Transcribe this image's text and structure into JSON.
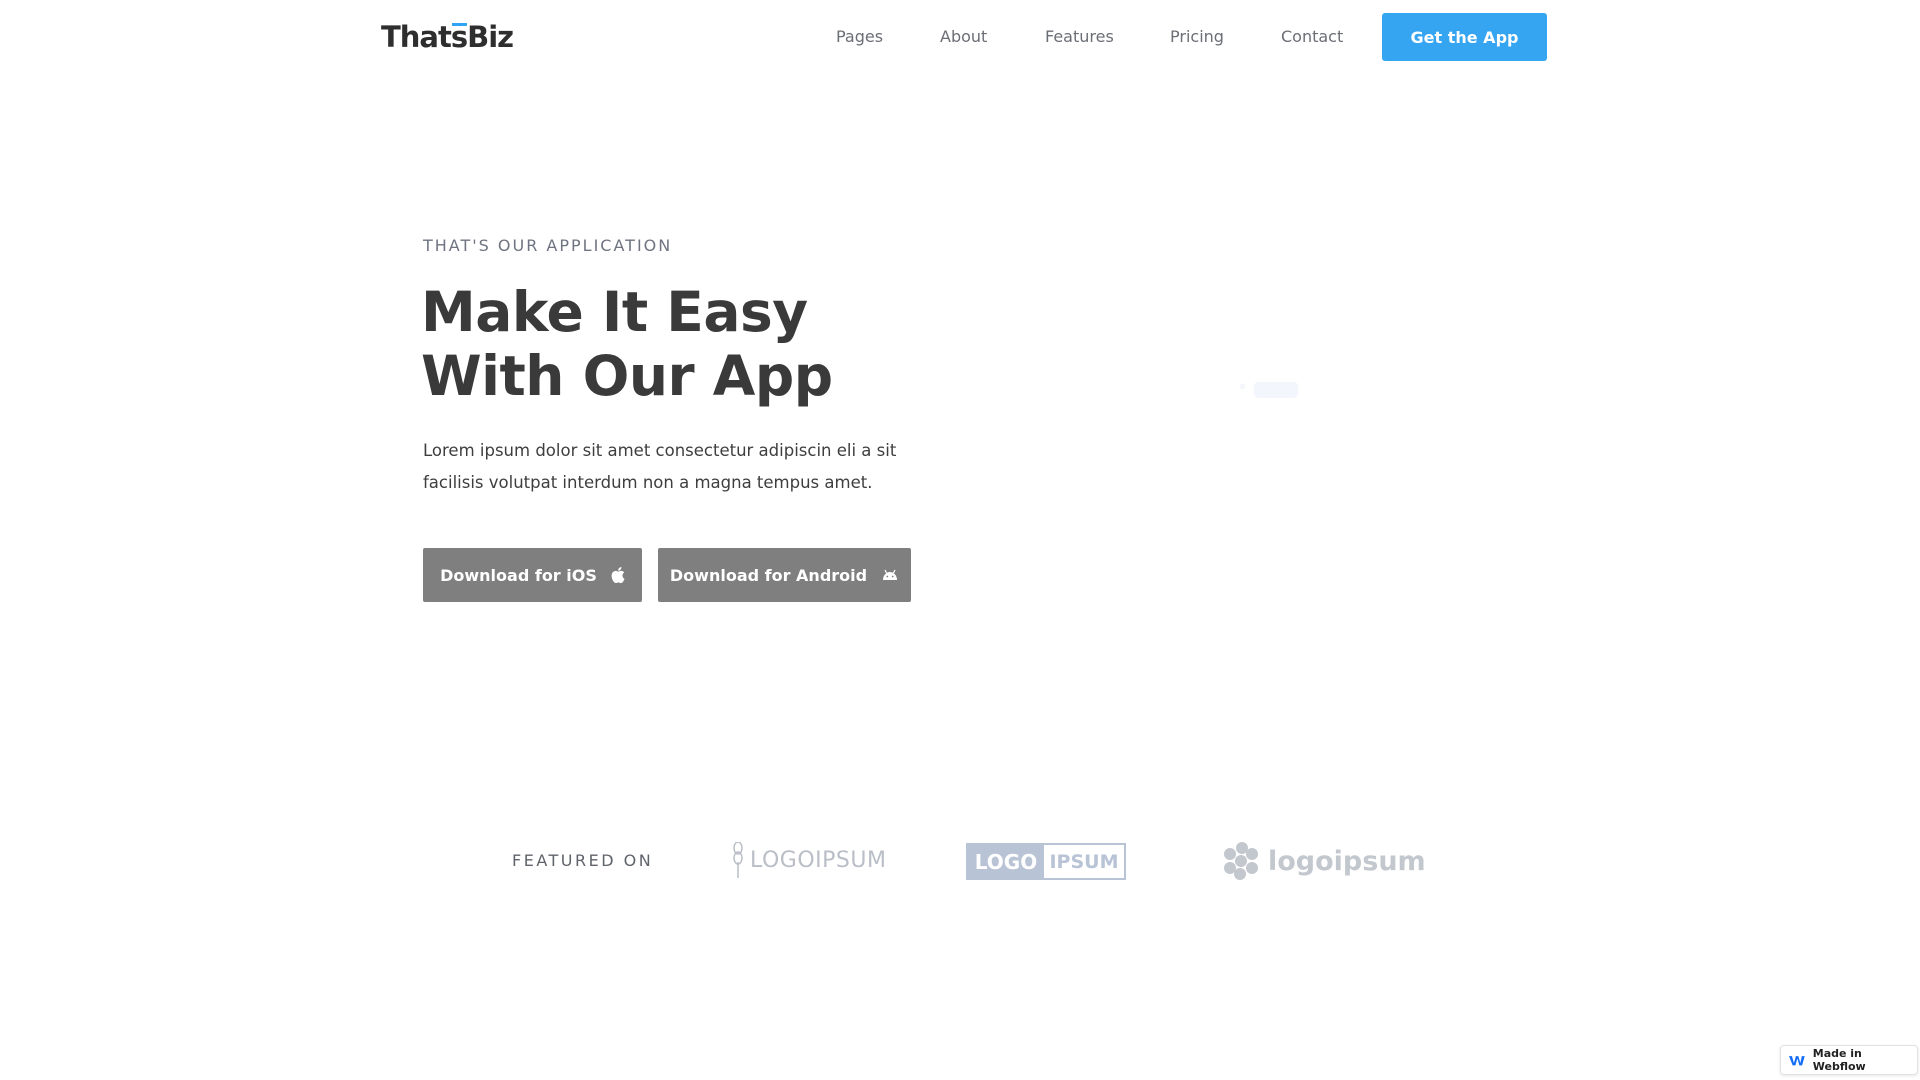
{
  "header": {
    "logo": "ThatsBiz",
    "nav": [
      {
        "label": "Pages"
      },
      {
        "label": "About"
      },
      {
        "label": "Features"
      },
      {
        "label": "Pricing"
      },
      {
        "label": "Contact"
      }
    ],
    "cta_label": "Get the App"
  },
  "hero": {
    "eyebrow": "THAT'S OUR APPLICATION",
    "headline_line1": "Make It Easy",
    "headline_line2": "With Our App",
    "description": "Lorem ipsum dolor sit amet consectetur adipiscin eli a sit facilisis volutpat interdum non a magna tempus amet.",
    "ios_button": "Download for iOS",
    "android_button": "Download for Android"
  },
  "featured": {
    "label": "FEATURED ON",
    "brand1": "LOGOIPSUM",
    "brand2_left": "LOGO",
    "brand2_right": "IPSUM",
    "brand3": "logoipsum"
  },
  "badge": {
    "label": "Made in Webflow"
  },
  "colors": {
    "accent": "#35a4f1",
    "button_gray": "#7f7f7f",
    "text_dark": "#3a3a3a"
  },
  "icons": [
    "apple-icon",
    "android-icon",
    "webflow-icon"
  ]
}
